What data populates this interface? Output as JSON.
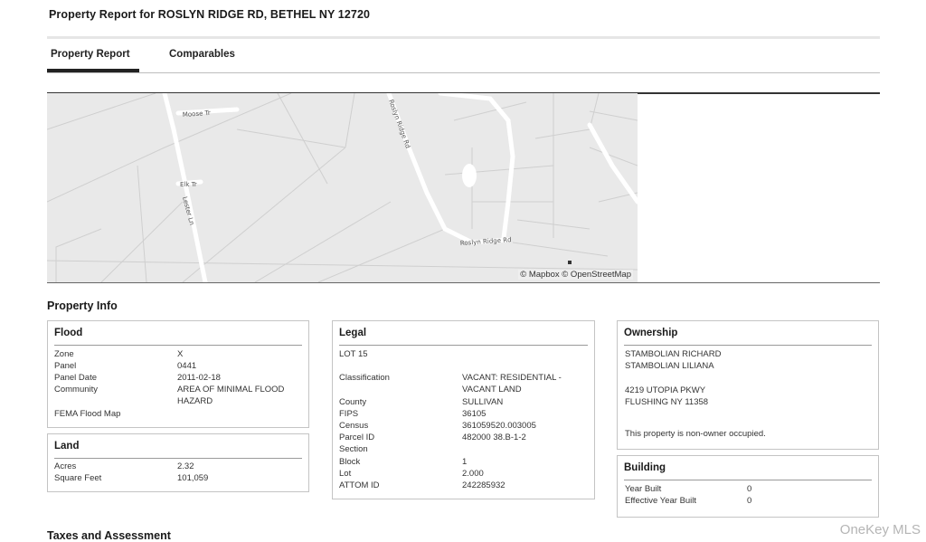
{
  "header": {
    "title": "Property Report for ROSLYN RIDGE RD, BETHEL NY 12720"
  },
  "tabs": [
    {
      "label": "Property Report",
      "active": true
    },
    {
      "label": "Comparables",
      "active": false
    }
  ],
  "map": {
    "street_labels": [
      "Moose Tr",
      "Roslyn Ridge Rd",
      "Elk Tr",
      "Lester Ln",
      "Roslyn Ridge Rd"
    ],
    "attribution": "© Mapbox © OpenStreetMap"
  },
  "property_info": {
    "heading": "Property Info",
    "flood": {
      "title": "Flood",
      "rows": [
        {
          "label": "Zone",
          "value": "X"
        },
        {
          "label": "Panel",
          "value": "0441"
        },
        {
          "label": "Panel Date",
          "value": "2011-02-18"
        },
        {
          "label": "Community",
          "value": "AREA OF MINIMAL FLOOD HAZARD"
        },
        {
          "label": "FEMA Flood Map",
          "value": ""
        }
      ]
    },
    "land": {
      "title": "Land",
      "rows": [
        {
          "label": "Acres",
          "value": "2.32"
        },
        {
          "label": "Square Feet",
          "value": "101,059"
        }
      ]
    },
    "legal": {
      "title": "Legal",
      "lot_line": "LOT 15",
      "rows": [
        {
          "label": "Classification",
          "value": "VACANT: RESIDENTIAL - VACANT LAND"
        },
        {
          "label": "County",
          "value": "SULLIVAN"
        },
        {
          "label": "FIPS",
          "value": "36105"
        },
        {
          "label": "Census",
          "value": "361059520.003005"
        },
        {
          "label": "Parcel ID",
          "value": "482000 38.B-1-2"
        },
        {
          "label": "Section",
          "value": ""
        },
        {
          "label": "Block",
          "value": "1"
        },
        {
          "label": "Lot",
          "value": "2.000"
        },
        {
          "label": "ATTOM ID",
          "value": "242285932"
        }
      ]
    },
    "ownership": {
      "title": "Ownership",
      "owners": [
        "STAMBOLIAN RICHARD",
        "STAMBOLIAN LILIANA"
      ],
      "address": [
        "4219 UTOPIA PKWY",
        "FLUSHING NY 11358"
      ],
      "note": "This property is non-owner occupied."
    },
    "building": {
      "title": "Building",
      "rows": [
        {
          "label": "Year Built",
          "value": "0"
        },
        {
          "label": "Effective Year Built",
          "value": "0"
        }
      ]
    }
  },
  "taxes": {
    "heading": "Taxes and Assessment"
  },
  "watermark": "OneKey MLS"
}
